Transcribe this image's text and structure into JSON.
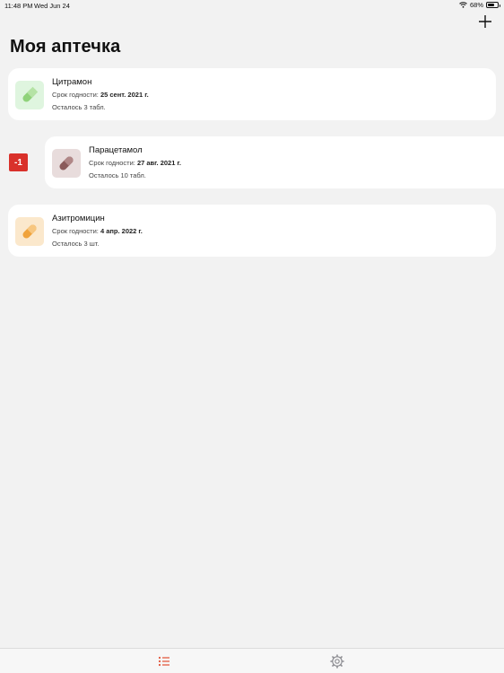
{
  "status_bar": {
    "time": "11:48 PM",
    "date": "Wed Jun 24",
    "battery": "68%"
  },
  "header": {
    "title": "Моя аптечка",
    "add_icon": "plus-icon"
  },
  "medicines": [
    {
      "name": "Цитрамон",
      "expiry_label": "Срок годности:",
      "expiry_date": "25 сент. 2021 г.",
      "remaining": "Осталось 3 табл.",
      "tile_color": "#dff5df",
      "pill_color": "#8fd27a",
      "icon": "pill-icon"
    },
    {
      "name": "Парацетамол",
      "expiry_label": "Срок годности:",
      "expiry_date": "27 авг. 2021 г.",
      "remaining": "Осталось 10 табл.",
      "tile_color": "#e8dcdc",
      "pill_color": "#8a5a5a",
      "icon": "pill-icon"
    },
    {
      "name": "Азитромицин",
      "expiry_label": "Срок годности:",
      "expiry_date": "4 апр. 2022 г.",
      "remaining": "Осталось 3 шт.",
      "tile_color": "#fbe8cc",
      "pill_color": "#f0a33c",
      "icon": "pill-icon"
    }
  ],
  "swipe_action": {
    "label": "-1",
    "color": "#d9312b"
  },
  "tab_bar": {
    "tabs": [
      {
        "icon": "list-icon",
        "active": true,
        "color": "#e2553b"
      },
      {
        "icon": "gear-icon",
        "active": false,
        "color": "#8e8e93"
      }
    ]
  }
}
